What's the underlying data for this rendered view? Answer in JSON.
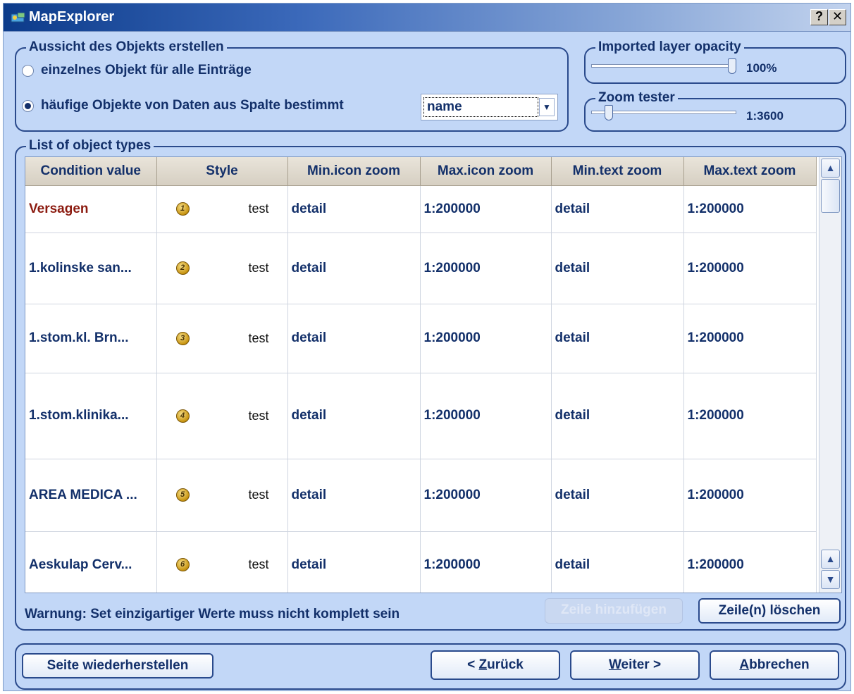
{
  "window": {
    "title": "MapExplorer",
    "help_label": "?",
    "close_label": "✕"
  },
  "appearance": {
    "legend": "Aussicht des Objekts erstellen",
    "radio_single": "einzelnes Objekt für alle Einträge",
    "radio_common": "häufige Objekte von Daten aus Spalte bestimmt",
    "column_select": "name"
  },
  "opacity": {
    "legend": "Imported layer opacity",
    "value": "100%",
    "level": 1.0
  },
  "zoom": {
    "legend": "Zoom tester",
    "value": "1:3600",
    "level": 0.1
  },
  "list": {
    "legend": "List of object types",
    "headers": [
      "Condition value",
      "Style",
      "Min.icon zoom",
      "Max.icon zoom",
      "Min.text zoom",
      "Max.text zoom"
    ],
    "rows": [
      {
        "condition": "Versagen",
        "badge": "1",
        "style": "test",
        "min_icon": "detail",
        "max_icon": "1:200000",
        "min_text": "detail",
        "max_text": "1:200000"
      },
      {
        "condition": "1.kolinske san...",
        "badge": "2",
        "style": "test",
        "min_icon": "detail",
        "max_icon": "1:200000",
        "min_text": "detail",
        "max_text": "1:200000"
      },
      {
        "condition": "1.stom.kl. Brn...",
        "badge": "3",
        "style": "test",
        "min_icon": "detail",
        "max_icon": "1:200000",
        "min_text": "detail",
        "max_text": "1:200000"
      },
      {
        "condition": "1.stom.klinika...",
        "badge": "4",
        "style": "test",
        "min_icon": "detail",
        "max_icon": "1:200000",
        "min_text": "detail",
        "max_text": "1:200000"
      },
      {
        "condition": "AREA MEDICA ...",
        "badge": "5",
        "style": "test",
        "min_icon": "detail",
        "max_icon": "1:200000",
        "min_text": "detail",
        "max_text": "1:200000"
      },
      {
        "condition": "Aeskulap Cerv...",
        "badge": "6",
        "style": "test",
        "min_icon": "detail",
        "max_icon": "1:200000",
        "min_text": "detail",
        "max_text": "1:200000"
      }
    ],
    "warning": "Warnung: Set einzigartiger Werte muss nicht komplett sein",
    "add_row": "Zeile hinzufügen",
    "delete_rows": "Zeile(n) löschen"
  },
  "footer": {
    "restore": "Seite wiederherstellen",
    "back_prefix": "< ",
    "back_key": "Z",
    "back_rest": "urück",
    "next_key": "W",
    "next_rest": "eiter >",
    "cancel_key": "A",
    "cancel_rest": "bbrechen"
  },
  "colors": {
    "dialog_bg": "#c2d7f7",
    "text": "#13306a",
    "first_row_text": "#8b1a0f",
    "title_bar": "#0c3b8a"
  }
}
